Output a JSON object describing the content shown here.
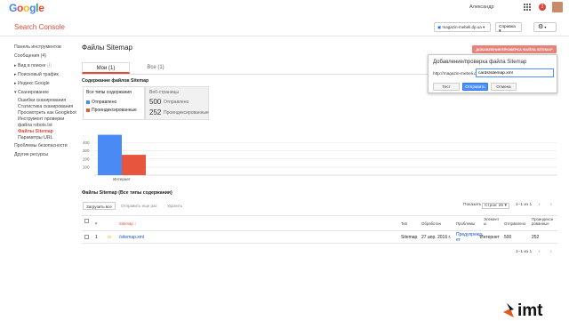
{
  "header": {
    "logo_letters": [
      {
        "ch": "G",
        "color": "#4285f4"
      },
      {
        "ch": "o",
        "color": "#ea4335"
      },
      {
        "ch": "o",
        "color": "#fbbc05"
      },
      {
        "ch": "g",
        "color": "#4285f4"
      },
      {
        "ch": "l",
        "color": "#34a853"
      },
      {
        "ch": "e",
        "color": "#ea4335"
      }
    ],
    "user_name": "Александр",
    "notifications_count": "2",
    "product_title": "Search Console",
    "site_selector": "magazin-mebeli.dp.ua",
    "help_label": "Справка",
    "settings_icon": "gear-icon"
  },
  "sidebar": {
    "items": [
      {
        "label": "Панель инструментов",
        "sub": false,
        "active": false
      },
      {
        "label": "Сообщения (4)",
        "sub": false,
        "active": false
      },
      {
        "label": "▸ Вид в поиске  ⓘ",
        "sub": false,
        "active": false
      },
      {
        "label": "▸ Поисковый трафик",
        "sub": false,
        "active": false
      },
      {
        "label": "▸ Индекс Google",
        "sub": false,
        "active": false
      },
      {
        "label": "▾ Сканирование",
        "sub": false,
        "active": false
      },
      {
        "label": "Ошибки сканирования",
        "sub": true,
        "active": false
      },
      {
        "label": "Статистика сканирования",
        "sub": true,
        "active": false
      },
      {
        "label": "Просмотреть как Googlebot",
        "sub": true,
        "active": false
      },
      {
        "label": "Инструмент проверки",
        "sub": true,
        "active": false
      },
      {
        "label": "файла robots.txt",
        "sub": true,
        "active": false
      },
      {
        "label": "Файлы Sitemap",
        "sub": true,
        "active": true
      },
      {
        "label": "Параметры URL",
        "sub": true,
        "active": false
      },
      {
        "label": "Проблемы безопасности",
        "sub": false,
        "active": false
      },
      {
        "label": "Другие ресурсы",
        "sub": false,
        "active": false
      }
    ]
  },
  "main": {
    "page_title": "Файлы Sitemap",
    "add_button": "ДОБАВЛЕНИЕ/ПРОВЕРКА ФАЙЛА SITEMAP",
    "tabs": [
      {
        "label": "Мои (1)"
      },
      {
        "label": "Все (1)"
      }
    ],
    "content_label": "Содержание файлов Sitemap",
    "legend": {
      "title": "Все типы содержания",
      "submitted": "Отправлено",
      "indexed": "Проиндексированные",
      "submitted_color": "#4a8af4",
      "indexed_color": "#e8553f"
    },
    "stats": {
      "title": "Веб-страницы",
      "submitted_value": "500",
      "submitted_label": "Отправлено",
      "indexed_value": "252",
      "indexed_label": "Проиндексированные"
    },
    "table_title": "Файлы Sitemap (Все типы содержания)",
    "toolbar": {
      "load_all": "Загрузить все",
      "resubmit": "Отправить еще раз",
      "delete": "Удалить",
      "show": "Показать",
      "rows": "Строк: 25",
      "range": "1–1 из 1"
    },
    "columns": {
      "num": "#",
      "sitemap": "Sitemap",
      "type": "Тип",
      "processed": "Обработан",
      "issues": "Проблемы",
      "items_1": "Элемент",
      "items_2": "ы",
      "submitted": "Отправлено",
      "indexed_1": "Проиндекси",
      "indexed_2": "рованные"
    },
    "rows": [
      {
        "num": "1",
        "sitemap": "/sitemap.xml",
        "type": "Sitemap",
        "processed": "27 апр. 2016 г.",
        "issues_1": "Предупрежд",
        "issues_2": "ет",
        "items": "Интернет",
        "submitted": "500",
        "indexed": "252"
      }
    ],
    "footer_range": "1–1 из 1"
  },
  "chart_data": {
    "type": "bar",
    "categories": [
      "Интернет"
    ],
    "series": [
      {
        "name": "Отправлено",
        "values": [
          500
        ]
      },
      {
        "name": "Проиндексированные",
        "values": [
          252
        ]
      }
    ],
    "yticks": [
      "400",
      "300",
      "200",
      "100"
    ],
    "ylim": [
      0,
      550
    ],
    "title": "",
    "xlabel": "",
    "ylabel": ""
  },
  "popup": {
    "title": "Добавление/проверка файла Sitemap",
    "url_prefix": "http://magazin-mebeli.dp.ua/",
    "input_value": "cards/sitemap.xml",
    "test_label": "Тест",
    "submit_label": "Отправить",
    "cancel_label": "Отмена"
  },
  "watermark_text": "imt"
}
